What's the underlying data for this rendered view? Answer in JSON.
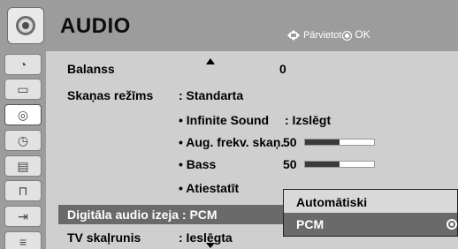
{
  "header": {
    "title": "AUDIO",
    "nav_text": "Pārvietot",
    "ok_text": "OK"
  },
  "sidebar": {
    "items": [
      {
        "icon": "satellite-dish-icon"
      },
      {
        "icon": "picture-icon"
      },
      {
        "icon": "audio-speaker-icon",
        "active": true
      },
      {
        "icon": "clock-icon"
      },
      {
        "icon": "options-icon"
      },
      {
        "icon": "lock-icon"
      },
      {
        "icon": "input-connector-icon"
      },
      {
        "icon": "usb-icon"
      }
    ]
  },
  "menu": {
    "balance": {
      "label": "Balanss",
      "value": "0"
    },
    "sound_mode": {
      "label": "Skaņas režīms",
      "value": ": Standarta"
    },
    "infinite_sound": {
      "label": "• Infinite Sound",
      "value": ": Izslēgt"
    },
    "treble": {
      "label": "• Aug. frekv. skaņ.",
      "value": "50",
      "level": 0.5
    },
    "bass": {
      "label": "• Bass",
      "value": "50",
      "level": 0.5
    },
    "reset": {
      "label": "• Atiestatīt"
    },
    "digital_audio_out": {
      "label": "Digitāla audio izeja : PCM"
    },
    "tv_speaker": {
      "label": "TV skaļrunis",
      "value": ": Ieslēgta"
    }
  },
  "popup": {
    "options": [
      "Automātiski",
      "PCM"
    ],
    "selected": "PCM"
  },
  "colors": {
    "header_bg": "#9c9c9c",
    "content_bg": "#cfcfcf",
    "selection_bg": "#6a6a6a"
  }
}
